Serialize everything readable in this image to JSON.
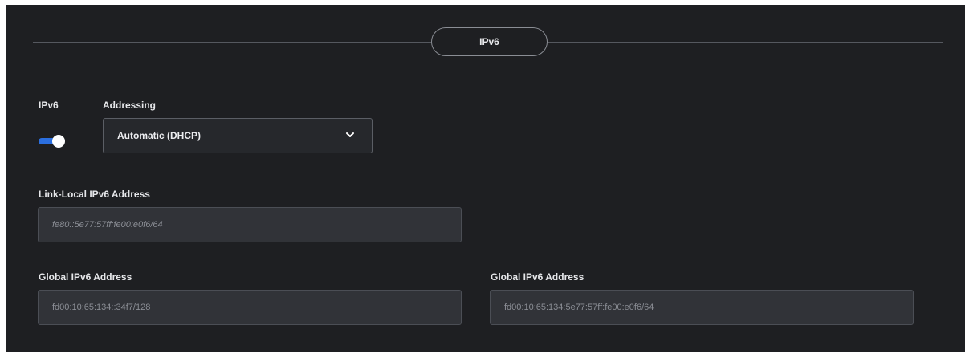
{
  "section": {
    "title": "IPv6"
  },
  "ipv6_toggle": {
    "label": "IPv6",
    "state": "on",
    "accent_color": "#2b6fe0"
  },
  "addressing": {
    "label": "Addressing",
    "selected": "Automatic (DHCP)",
    "icon": "chevron-down-icon"
  },
  "link_local": {
    "label": "Link-Local IPv6 Address",
    "value": "fe80::5e77:57ff:fe00:e0f6/64"
  },
  "global_1": {
    "label": "Global IPv6 Address",
    "value": "fd00:10:65:134::34f7/128"
  },
  "global_2": {
    "label": "Global IPv6 Address",
    "value": "fd00:10:65:134:5e77:57ff:fe00:e0f6/64"
  }
}
